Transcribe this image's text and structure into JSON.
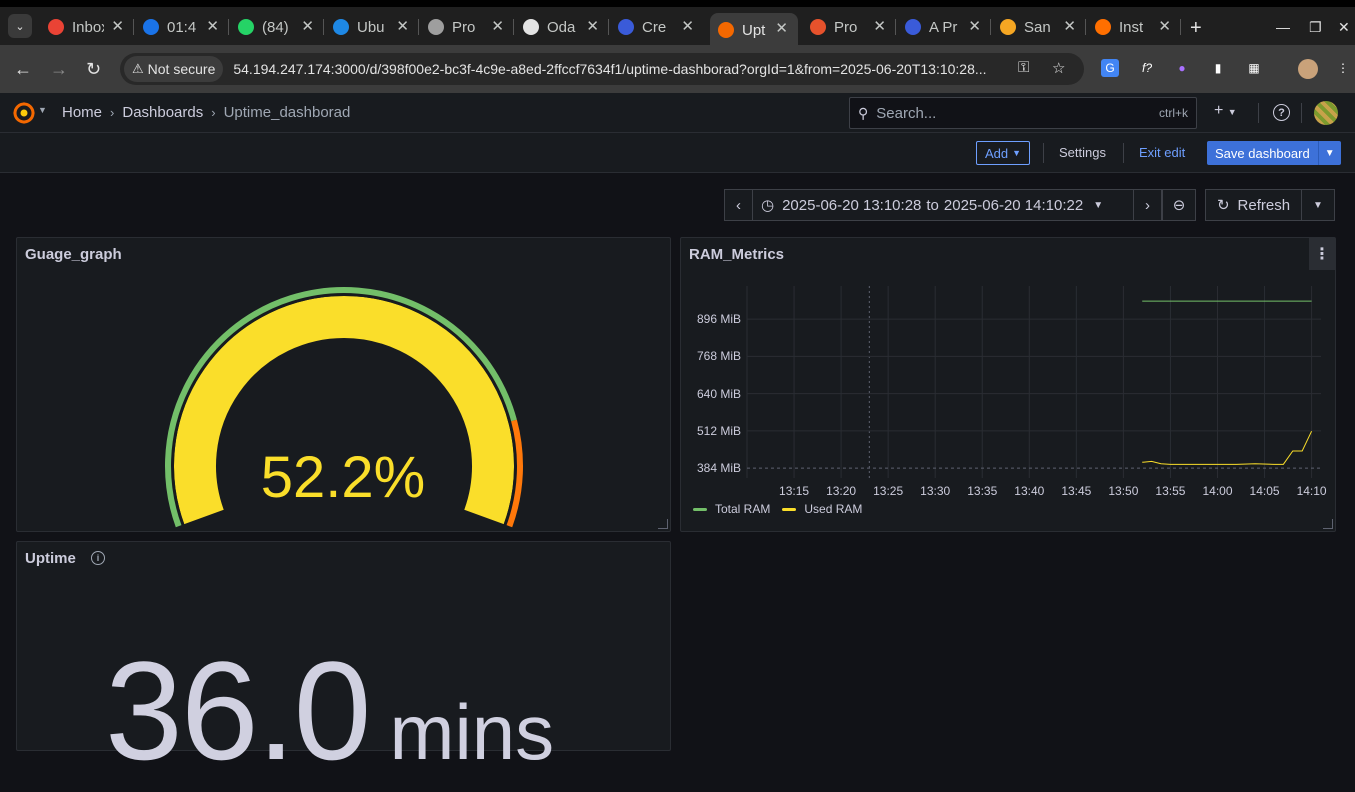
{
  "browser": {
    "tabs": [
      {
        "label": "Inbox",
        "fav_color": "#ea4335"
      },
      {
        "label": "01:4",
        "fav_color": "#1a73e8"
      },
      {
        "label": "(84)",
        "fav_color": "#25d366"
      },
      {
        "label": "Ubu",
        "fav_color": "#1e88e5"
      },
      {
        "label": "Pro",
        "fav_color": "#9e9e9e"
      },
      {
        "label": "Oda",
        "fav_color": "#e3e3e3"
      },
      {
        "label": "Cre",
        "fav_color": "#3a5bd9"
      },
      {
        "label": "Upt",
        "fav_color": "#f46800",
        "active": true
      },
      {
        "label": "Pro",
        "fav_color": "#e6522c"
      },
      {
        "label": "A Pr",
        "fav_color": "#3a5bd9"
      },
      {
        "label": "San",
        "fav_color": "#f5a623"
      },
      {
        "label": "Inst",
        "fav_color": "#ff6f00"
      }
    ],
    "security_label": "Not secure",
    "url": "54.194.247.174:3000/d/398f00e2-bc3f-4c9e-a8ed-2ffccf7634f1/uptime-dashborad?orgId=1&from=2025-06-20T13:10:28..."
  },
  "grafana": {
    "breadcrumbs": [
      "Home",
      "Dashboards",
      "Uptime_dashborad"
    ],
    "search_placeholder": "Search...",
    "search_shortcut": "ctrl+k",
    "toolbar": {
      "add_label": "Add",
      "settings_label": "Settings",
      "exit_edit_label": "Exit edit",
      "save_label": "Save dashboard"
    },
    "time": {
      "from": "2025-06-20 13:10:28",
      "to_word": "to",
      "to": "2025-06-20 14:10:22",
      "refresh_label": "Refresh"
    }
  },
  "panels": {
    "gauge": {
      "title": "Guage_graph",
      "value_text": "52.2%",
      "value": 52.2,
      "colors": {
        "arc": "#fade2a",
        "threshold_ok": "#73bf69",
        "threshold_warn": "#ff780a"
      }
    },
    "ram": {
      "title": "RAM_Metrics",
      "legend": [
        {
          "name": "Total RAM",
          "color": "#73bf69"
        },
        {
          "name": "Used RAM",
          "color": "#fade2a"
        }
      ]
    },
    "uptime": {
      "title": "Uptime",
      "value": "36.0",
      "unit": "mins"
    }
  },
  "chart_data": {
    "type": "line",
    "title": "RAM_Metrics",
    "y_tick_labels": [
      "384 MiB",
      "512 MiB",
      "640 MiB",
      "768 MiB",
      "896 MiB"
    ],
    "y_ticks": [
      384,
      512,
      640,
      768,
      896
    ],
    "x_tick_labels": [
      "13:15",
      "13:20",
      "13:25",
      "13:30",
      "13:35",
      "13:40",
      "13:45",
      "13:50",
      "13:55",
      "14:00",
      "14:05",
      "14:10"
    ],
    "ylim": [
      350,
      1010
    ],
    "x_minutes_range": [
      "13:10",
      "14:11"
    ],
    "series": [
      {
        "name": "Total RAM",
        "color": "#73bf69",
        "x": [
          "13:52",
          "13:55",
          "14:00",
          "14:05",
          "14:10"
        ],
        "y": [
          958,
          958,
          958,
          958,
          958
        ]
      },
      {
        "name": "Used RAM",
        "color": "#fade2a",
        "x": [
          "13:52",
          "13:53",
          "13:54",
          "13:55",
          "13:58",
          "14:00",
          "14:02",
          "14:04",
          "14:06",
          "14:07",
          "14:08",
          "14:09",
          "14:10"
        ],
        "y": [
          404,
          407,
          399,
          397,
          397,
          397,
          397,
          399,
          397,
          397,
          443,
          443,
          511
        ]
      }
    ],
    "grid": true,
    "legend_position": "bottom-left"
  }
}
